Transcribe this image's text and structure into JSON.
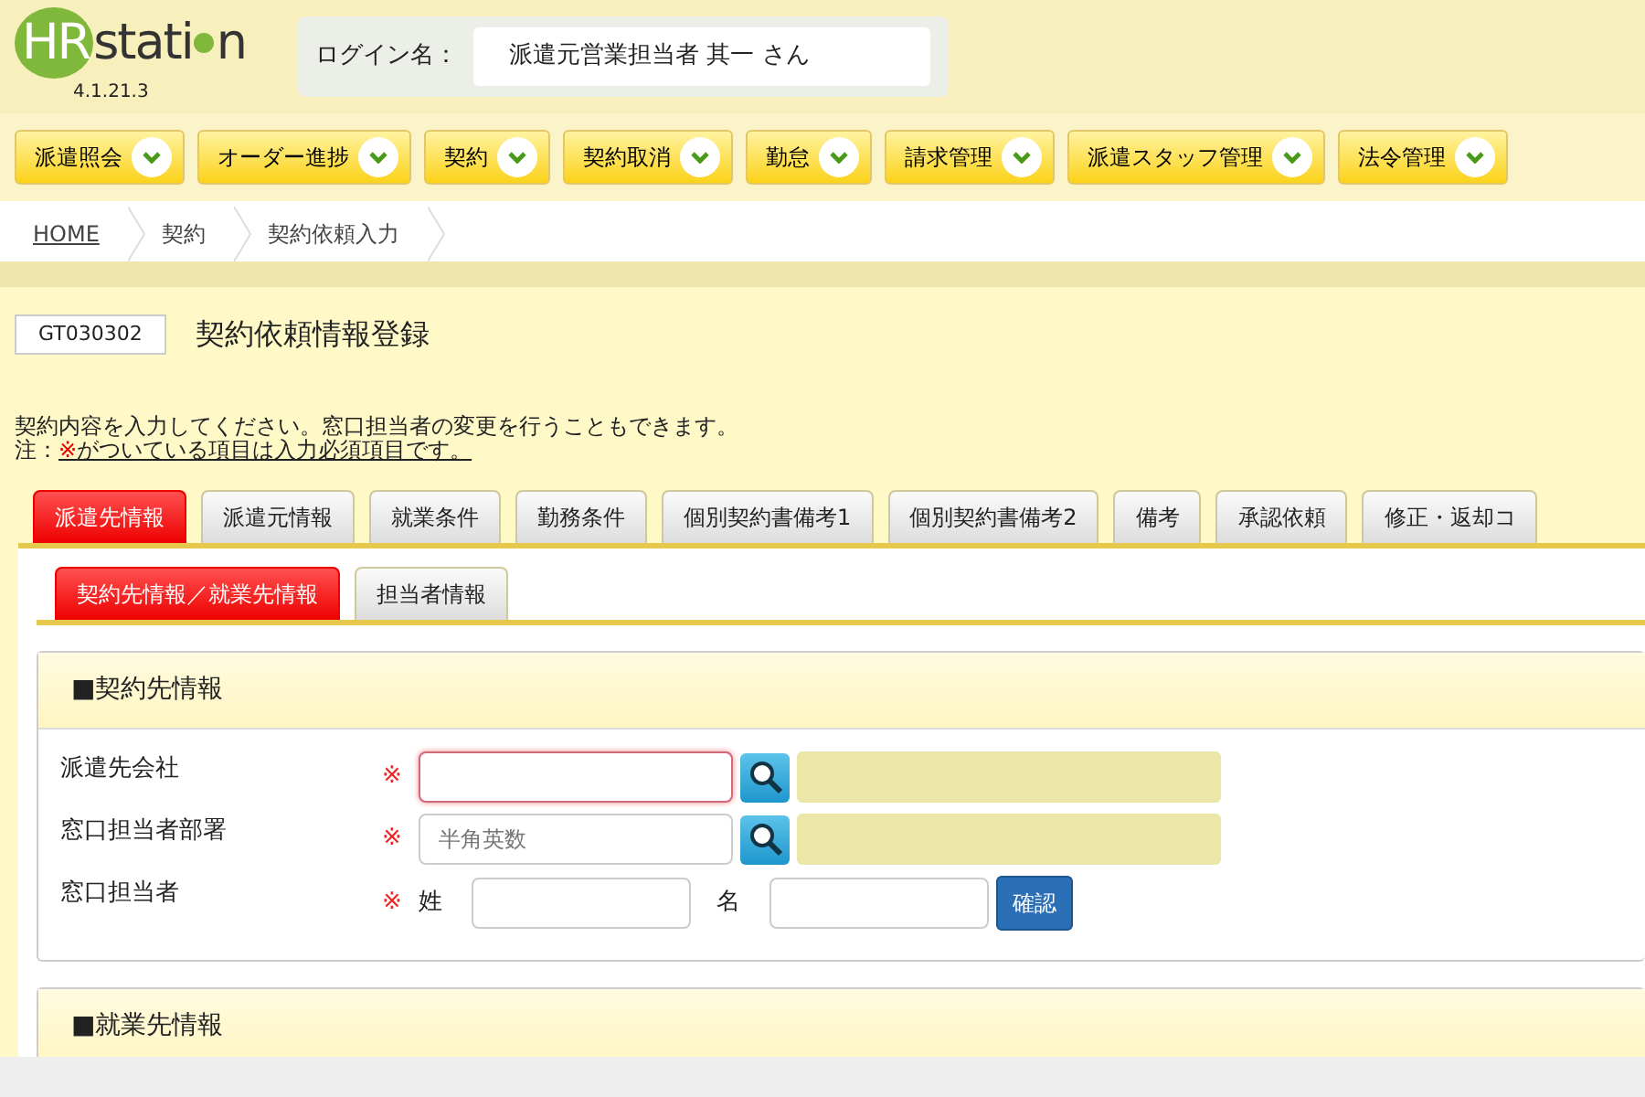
{
  "header": {
    "logo_prefix": "HR",
    "logo_suffix": "stati",
    "logo_end": "n",
    "version": "4.1.21.3",
    "login_label": "ログイン名：",
    "login_name": "派遣元営業担当者 其一 さん"
  },
  "menu": [
    {
      "label": "派遣照会"
    },
    {
      "label": "オーダー進捗"
    },
    {
      "label": "契約"
    },
    {
      "label": "契約取消"
    },
    {
      "label": "勤怠"
    },
    {
      "label": "請求管理"
    },
    {
      "label": "派遣スタッフ管理"
    },
    {
      "label": "法令管理"
    }
  ],
  "breadcrumb": [
    {
      "label": "HOME",
      "link": true
    },
    {
      "label": "契約",
      "link": false
    },
    {
      "label": "契約依頼入力",
      "link": false
    }
  ],
  "page": {
    "code": "GT030302",
    "title": "契約依頼情報登録",
    "instruction": "契約内容を入力してください。窓口担当者の変更を行うこともできます。",
    "note_prefix": "注：",
    "note_mark": "※",
    "note_text": "がついている項目は入力必須項目です。"
  },
  "tabs": [
    {
      "label": "派遣先情報",
      "selected": true
    },
    {
      "label": "派遣元情報",
      "selected": false
    },
    {
      "label": "就業条件",
      "selected": false
    },
    {
      "label": "勤務条件",
      "selected": false
    },
    {
      "label": "個別契約書備考1",
      "selected": false
    },
    {
      "label": "個別契約書備考2",
      "selected": false
    },
    {
      "label": "備考",
      "selected": false
    },
    {
      "label": "承認依頼",
      "selected": false
    },
    {
      "label": "修正・返却コ",
      "selected": false
    }
  ],
  "subtabs": [
    {
      "label": "契約先情報／就業先情報",
      "selected": true
    },
    {
      "label": "担当者情報",
      "selected": false
    }
  ],
  "sections": [
    {
      "title": "■契約先情報",
      "rows": [
        {
          "kind": "lookup",
          "label": "派遣先会社",
          "required_mark": "※",
          "focused": true
        },
        {
          "kind": "lookup",
          "label": "窓口担当者部署",
          "required_mark": "※",
          "placeholder": "半角英数",
          "focused": false
        },
        {
          "kind": "name",
          "label": "窓口担当者",
          "required_mark": "※",
          "last_label": "姓",
          "first_label": "名",
          "button": "確認"
        }
      ]
    },
    {
      "title": "■就業先情報"
    }
  ]
}
